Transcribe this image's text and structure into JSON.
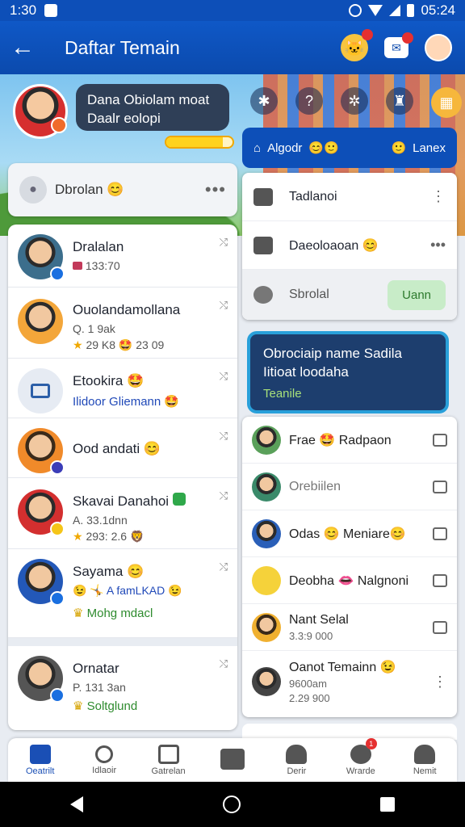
{
  "status_bar": {
    "time": "1:30",
    "clock_right": "05:24"
  },
  "app_bar": {
    "title": "Daftar Temain"
  },
  "banner": {
    "bubble_text": "Dana Obiolam moat Daalr eolopi",
    "progress_fraction": 0.85
  },
  "right_tabs": {
    "left_label": "Algodr",
    "right_label": "Lanex"
  },
  "chat_button": {
    "label": "Dbrolan 😊"
  },
  "left_list": [
    {
      "name": "Dralalan",
      "sub": "133:70",
      "x": "⤭"
    },
    {
      "name": "Ouolandamollana",
      "sub": "Q. 1 9ak",
      "sub2": "29 K8 🤩 23 09",
      "x": "⤭"
    },
    {
      "name": "Etookira 🤩",
      "blue": "Ilidoor Gliemann 🤩",
      "x": "⤭"
    },
    {
      "name": "Ood andati 😊",
      "x": "⤭"
    },
    {
      "name": "Skavai Danahoi",
      "sub": "A. 33.1dnn",
      "sub2": "293: 2.6 🦁",
      "x": "⤭"
    },
    {
      "name": "Sayama 😊",
      "sub": "😉 🤸 A famLKAD 😉",
      "green": "Mohg mdacl",
      "x": "⤭"
    },
    {
      "name": "Ornatar",
      "sub": "P. 131 3an",
      "green": "Soltglund",
      "x": "⤭"
    }
  ],
  "menu": [
    {
      "label": "Tadlanoi"
    },
    {
      "label": "Daeoloaoan 😊"
    },
    {
      "label": "Sbrolal",
      "pill": "Uann"
    }
  ],
  "tooltip": {
    "text": "Obrociaip name Sadila Iitioat loodaha",
    "link": "Teanile"
  },
  "right_list": [
    {
      "name": "Frae 🤩 Radpaon"
    },
    {
      "name": "Orebiilen",
      "grey": true
    },
    {
      "name": "Odas 😊 Meniare😊"
    },
    {
      "name": "Deobha 👄 Nalgnoni"
    },
    {
      "name": "Nant Selal",
      "sub": "3.3:9 000"
    },
    {
      "name": "Oanot Temainn 😉",
      "sub": "9600am",
      "sub2": "2.29 900"
    }
  ],
  "bottom_nav": [
    {
      "label": "Oeatrilt",
      "active": true
    },
    {
      "label": "Idlaoir"
    },
    {
      "label": "Gatrelan"
    },
    {
      "label": ""
    },
    {
      "label": "Derir"
    },
    {
      "label": "Wrarde",
      "badge": "1"
    },
    {
      "label": "Nemit"
    }
  ],
  "icons": {
    "back": "arrow-left-icon",
    "search": "search-icon",
    "home": "home-icon"
  }
}
